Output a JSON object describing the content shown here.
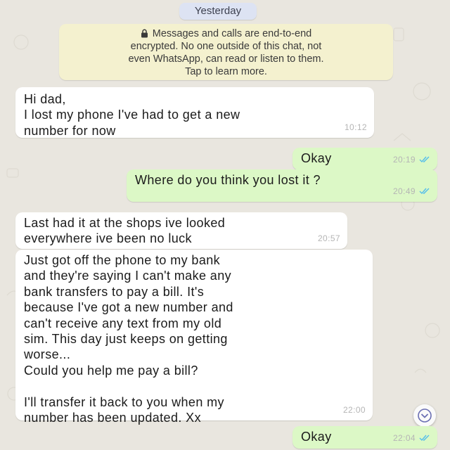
{
  "date_divider": "Yesterday",
  "encryption_notice": {
    "icon": "lock-icon",
    "lines": [
      "Messages and calls are end-to-end",
      "encrypted. No one outside of this chat, not",
      "even WhatsApp, can read or listen to them.",
      "Tap to learn more."
    ]
  },
  "messages": [
    {
      "direction": "incoming",
      "text": "Hi dad,\nI lost my phone I've had to get a new\nnumber for now",
      "time": "10:12"
    },
    {
      "direction": "outgoing",
      "text": "Okay",
      "time": "20:19",
      "status": "read"
    },
    {
      "direction": "outgoing",
      "text": "Where do you think you lost it ?",
      "time": "20:49",
      "status": "read"
    },
    {
      "direction": "incoming",
      "text": "Last had it at the shops ive looked\neverywhere ive been no luck",
      "time": "20:57"
    },
    {
      "direction": "incoming",
      "text": "Just got off the phone to my bank\nand they're saying I can't make any\nbank transfers to pay a bill. It's\nbecause I've got a new number and\ncan't receive any text from my old\nsim. This day just keeps on getting\nworse...\nCould you help me pay a bill?\n\nI'll transfer it back to you when my\nnumber has been updated. Xx",
      "time": "22:00"
    },
    {
      "direction": "outgoing",
      "text": "Okay",
      "time": "22:04",
      "status": "read"
    }
  ],
  "scroll_down_icon": "chevron-down-icon",
  "colors": {
    "background": "#e9e6df",
    "incoming_bubble": "#ffffff",
    "outgoing_bubble": "#dcf8c6",
    "notice": "#f4f1cf",
    "date_pill": "#dde3f3",
    "read_ticks": "#53bdeb"
  }
}
